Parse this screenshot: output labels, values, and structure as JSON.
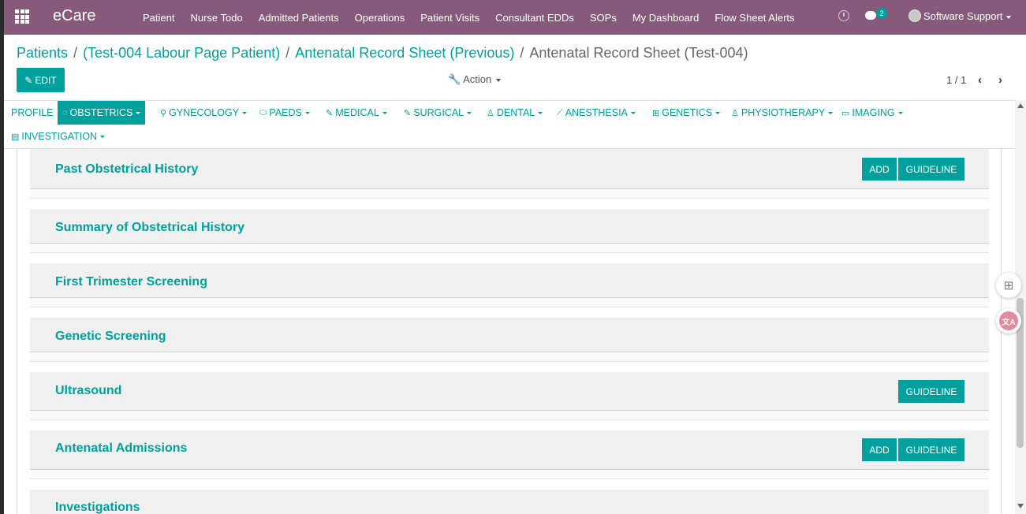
{
  "app": {
    "brand": "eCare",
    "menu": [
      "Patient",
      "Nurse Todo",
      "Admitted Patients",
      "Operations",
      "Patient Visits",
      "Consultant EDDs",
      "SOPs",
      "My Dashboard",
      "Flow Sheet Alerts"
    ],
    "chat_count": "2",
    "user_name": "Software Support"
  },
  "breadcrumb": {
    "items": [
      "Patients",
      "(Test-004 Labour Page Patient)",
      "Antenatal Record Sheet (Previous)"
    ],
    "current": "Antenatal Record Sheet (Test-004)",
    "separator": "/"
  },
  "controls": {
    "edit_label": "EDIT",
    "action_label": "Action",
    "pager": "1 / 1"
  },
  "tabs": [
    {
      "label": "PROFILE",
      "icon": "none"
    },
    {
      "label": "OBSTETRICS",
      "icon": "fetus-icon",
      "active": true
    },
    {
      "label": "GYNECOLOGY",
      "icon": "uterus-icon"
    },
    {
      "label": "PAEDS",
      "icon": "pill-icon"
    },
    {
      "label": "MEDICAL",
      "icon": "edit-icon"
    },
    {
      "label": "SURGICAL",
      "icon": "edit-icon"
    },
    {
      "label": "DENTAL",
      "icon": "doctor-icon"
    },
    {
      "label": "ANESTHESIA",
      "icon": "syringe-icon"
    },
    {
      "label": "GENETICS",
      "icon": "medkit-icon"
    },
    {
      "label": "PHYSIOTHERAPY",
      "icon": "doctor-icon"
    },
    {
      "label": "IMAGING",
      "icon": "monitor-icon"
    },
    {
      "label": "INVESTIGATION",
      "icon": "document-icon"
    }
  ],
  "sections": [
    {
      "title": "Past Obstetrical History",
      "buttons": [
        "ADD",
        "GUIDELINE"
      ]
    },
    {
      "title": "Summary of Obstetrical History",
      "buttons": []
    },
    {
      "title": "First Trimester Screening",
      "buttons": []
    },
    {
      "title": "Genetic Screening",
      "buttons": []
    },
    {
      "title": "Ultrasound",
      "buttons": [
        "GUIDELINE"
      ]
    },
    {
      "title": "Antenatal Admissions",
      "buttons": [
        "ADD",
        "GUIDELINE"
      ]
    },
    {
      "title": "Investigations",
      "buttons": []
    }
  ],
  "colors": {
    "navbar": "#875a7b",
    "primary": "#00a09d",
    "section_bg": "#f0f0f0"
  }
}
